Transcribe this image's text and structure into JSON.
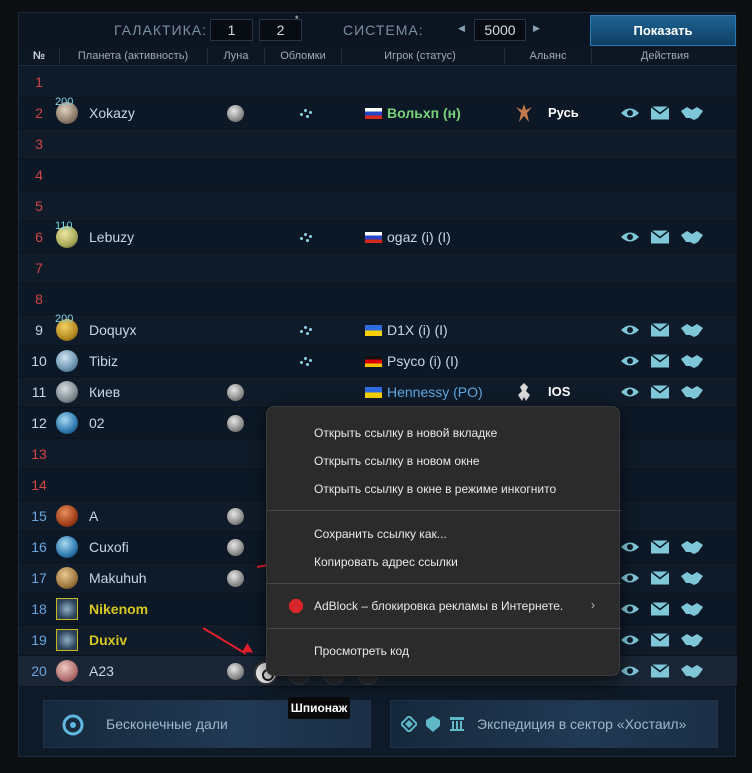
{
  "nav": {
    "galaxy_label": "ГАЛАКТИКА:",
    "galaxy_value": "1",
    "system_value_box": "2",
    "star": "*",
    "system_label": "СИСТЕМА:",
    "system_number": "5000",
    "prev_arrow": "◀",
    "next_arrow": "▶",
    "show_button": "Показать"
  },
  "headers": {
    "pos": "№",
    "planet": "Планета (активность)",
    "moon": "Луна",
    "debris": "Обломки",
    "player": "Игрок (статус)",
    "alliance": "Альянс",
    "actions": "Действия"
  },
  "rows": [
    {
      "pos": "1"
    },
    {
      "pos": "2",
      "act": "200",
      "name": "Xokazy",
      "player": "Вольxп (н)",
      "ally": "Русь"
    },
    {
      "pos": "3"
    },
    {
      "pos": "4"
    },
    {
      "pos": "5"
    },
    {
      "pos": "6",
      "act": "110",
      "name": "Lebuzy",
      "player": "ogaz (i) (I)"
    },
    {
      "pos": "7"
    },
    {
      "pos": "8"
    },
    {
      "pos": "9",
      "act": "200",
      "name": "Doquyx",
      "player": "D1X (i) (I)"
    },
    {
      "pos": "10",
      "name": "Tibiz",
      "player": "Psyco (i) (I)"
    },
    {
      "pos": "11",
      "name": "Киев",
      "player": "Hennessy (PO)",
      "ally": "IOS"
    },
    {
      "pos": "12",
      "name": "02"
    },
    {
      "pos": "13"
    },
    {
      "pos": "14"
    },
    {
      "pos": "15",
      "name": "A"
    },
    {
      "pos": "16",
      "name": "Cuxofi"
    },
    {
      "pos": "17",
      "name": "Makuhuh"
    },
    {
      "pos": "18",
      "name": "Nikenom"
    },
    {
      "pos": "19",
      "name": "Duxiv"
    },
    {
      "pos": "20",
      "name": "A23"
    }
  ],
  "tooltip": "Шпионаж",
  "banners": {
    "left": "Бесконечные дали",
    "right": "Экспедиция в сектор «Хостаил»"
  },
  "context_menu": {
    "open_new_tab": "Открыть ссылку в новой вкладке",
    "open_new_window": "Открыть ссылку в новом окне",
    "open_incognito": "Открыть ссылку в окне в режиме инкогнито",
    "save_link": "Сохранить ссылку как...",
    "copy_link": "Копировать адрес ссылки",
    "adblock": "AdBlock – блокировка рекламы в Интернете.",
    "adblock_chevron": "›",
    "inspect": "Просмотреть код"
  },
  "colors": {
    "accent": "#1e6394",
    "empty_slot": "#d04545",
    "inactive_owner": "#d8c622",
    "action_icon": "#7fc6d8",
    "annotation_arrow": "#e0202a"
  }
}
